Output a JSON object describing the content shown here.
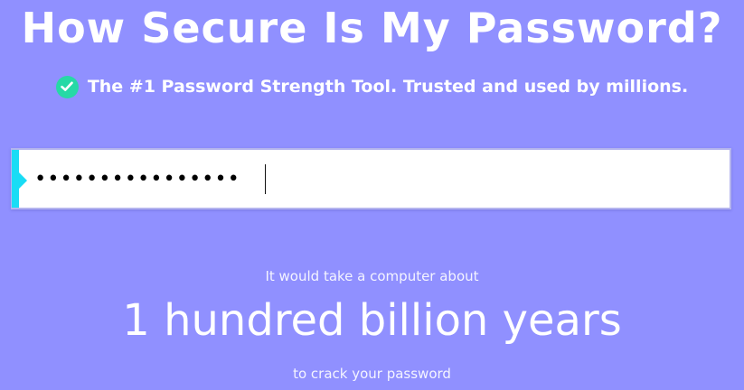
{
  "header": {
    "title": "How Secure Is My Password?",
    "tagline": "The #1 Password Strength Tool. Trusted and used by millions.",
    "tagline_icon": "check-circle-icon"
  },
  "password_field": {
    "masked_value": "••••••••••••••••"
  },
  "result": {
    "intro": "It would take a computer about",
    "crack_time": "1 hundred billion years",
    "outro": "to crack your password"
  },
  "colors": {
    "background": "#9090ff",
    "check_icon": "#26d9a6",
    "strength_marker": "#19dcf5",
    "text": "#ffffff"
  }
}
